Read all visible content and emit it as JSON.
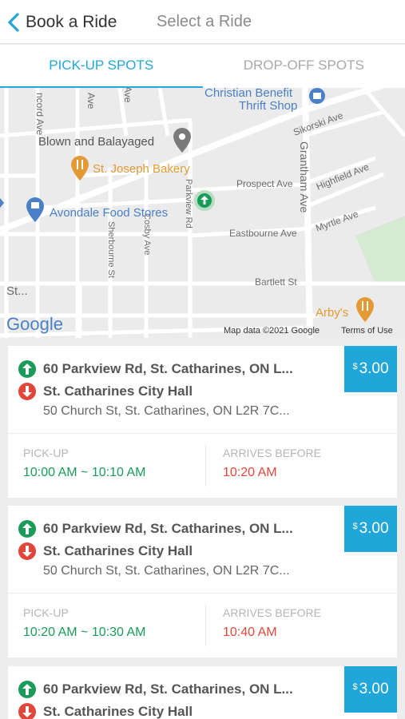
{
  "header": {
    "back_label": "Book a Ride",
    "subtitle": "Select a Ride"
  },
  "tabs": [
    {
      "label": "PICK-UP SPOTS",
      "active": true
    },
    {
      "label": "DROP-OFF SPOTS",
      "active": false
    }
  ],
  "map": {
    "places": {
      "thrift": "Christian Benefit",
      "thrift2": "Thrift Shop",
      "salon": "Blown and Balayaged",
      "bakery": "St. Joseph Bakery",
      "food": "Avondale Food Stores",
      "arbys": "Arby's",
      "st": "St..."
    },
    "streets": {
      "concord": "ncord Ave",
      "ave1": "Ave",
      "ave2": "Ave",
      "sikorski": "Sikorski Ave",
      "grantham": "Grantham Ave",
      "highfield": "Highfield Ave",
      "prospect": "Prospect Ave",
      "parkview": "Parkview Rd",
      "myrtle": "Myrtle Ave",
      "eastbourne": "Eastbourne Ave",
      "sherbourne": "Sherbourne St",
      "cosby": "Cosby Ave",
      "bartlett": "Bartlett St"
    },
    "google_logo": "Google",
    "map_data": "Map data ©2021 Google",
    "terms": "Terms of Use"
  },
  "rides": [
    {
      "from": "60 Parkview Rd, St. Catharines, ON L...",
      "dest": "St. Catharines City Hall",
      "dest_addr": "50 Church St, St. Catharines, ON L2R 7C...",
      "currency": "$",
      "price": "3.00",
      "pickup_label": "PICK-UP",
      "pickup": "10:00 AM ~ 10:10 AM",
      "arrive_label": "ARRIVES BEFORE",
      "arrive": "10:20 AM"
    },
    {
      "from": "60 Parkview Rd, St. Catharines, ON L...",
      "dest": "St. Catharines City Hall",
      "dest_addr": "50 Church St, St. Catharines, ON L2R 7C...",
      "currency": "$",
      "price": "3.00",
      "pickup_label": "PICK-UP",
      "pickup": "10:20 AM ~ 10:30 AM",
      "arrive_label": "ARRIVES BEFORE",
      "arrive": "10:40 AM"
    },
    {
      "from": "60 Parkview Rd, St. Catharines, ON L...",
      "dest": "St. Catharines City Hall",
      "currency": "$",
      "price": "3.00"
    }
  ],
  "colors": {
    "accent": "#20a6d8",
    "pickup_green": "#1a9b5a",
    "dropoff_red": "#e0473a",
    "poi_blue": "#4a80c8",
    "poi_orange": "#e39a35"
  },
  "icons": {
    "back": "chevron-left-icon",
    "pickup": "arrow-up-circle-icon",
    "dropoff": "arrow-down-circle-icon",
    "spot": "green-arrow-pin-icon"
  }
}
